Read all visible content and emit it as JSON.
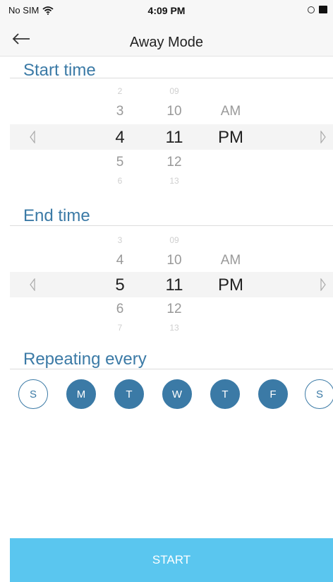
{
  "status_bar": {
    "carrier": "No SIM",
    "time": "4:09 PM"
  },
  "nav": {
    "title": "Away Mode",
    "back_icon": "arrow-left-icon"
  },
  "start_time": {
    "label": "Start time",
    "hours": [
      "2",
      "3",
      "4",
      "5",
      "6"
    ],
    "minutes": [
      "09",
      "10",
      "11",
      "12",
      "13"
    ],
    "periods": [
      "AM",
      "PM"
    ],
    "selected": {
      "hour": "4",
      "minute": "11",
      "period": "PM"
    }
  },
  "end_time": {
    "label": "End time",
    "hours": [
      "3",
      "4",
      "5",
      "6",
      "7"
    ],
    "minutes": [
      "09",
      "10",
      "11",
      "12",
      "13"
    ],
    "periods": [
      "AM",
      "PM"
    ],
    "selected": {
      "hour": "5",
      "minute": "11",
      "period": "PM"
    }
  },
  "repeat": {
    "label": "Repeating every",
    "days": [
      {
        "label": "S",
        "selected": false
      },
      {
        "label": "M",
        "selected": true
      },
      {
        "label": "T",
        "selected": true
      },
      {
        "label": "W",
        "selected": true
      },
      {
        "label": "T",
        "selected": true
      },
      {
        "label": "F",
        "selected": true
      },
      {
        "label": "S",
        "selected": false
      }
    ]
  },
  "start_button": {
    "label": "START"
  },
  "colors": {
    "accent": "#3b7aa6",
    "button": "#5ac6ef"
  }
}
